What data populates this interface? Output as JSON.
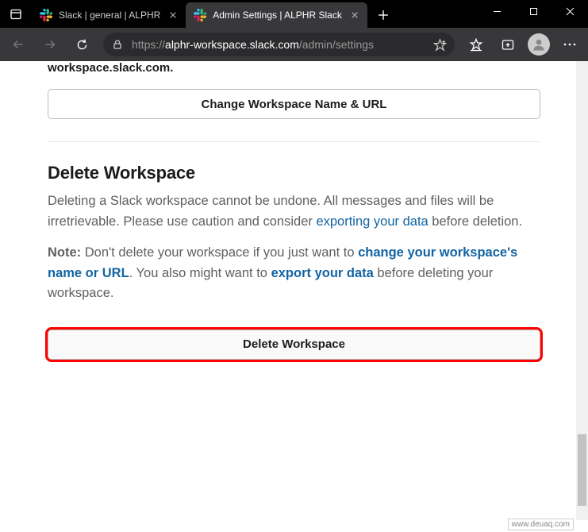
{
  "browser": {
    "tabs": [
      {
        "title": "Slack | general | ALPHR",
        "active": false
      },
      {
        "title": "Admin Settings | ALPHR Slack",
        "active": true
      }
    ],
    "url_display": {
      "protocol": "https://",
      "host_path": "alphr-workspace.slack.com",
      "rest": "/admin/settings"
    }
  },
  "page": {
    "partial_url_text": "workspace.slack.com",
    "change_btn": "Change Workspace Name & URL",
    "delete_section": {
      "title": "Delete Workspace",
      "p1_a": "Deleting a Slack workspace cannot be undone. All messages and files will be irretrievable. Please use caution and consider ",
      "p1_link": "exporting your data",
      "p1_b": " before deletion.",
      "note_label": "Note:",
      "p2_a": " Don't delete your workspace if you just want to ",
      "p2_link1": "change your workspace's name or URL",
      "p2_b": ". You also might want to ",
      "p2_link2": "export your data",
      "p2_c": " before deleting your workspace.",
      "delete_btn": "Delete Workspace"
    }
  },
  "watermark": "www.deuaq.com"
}
